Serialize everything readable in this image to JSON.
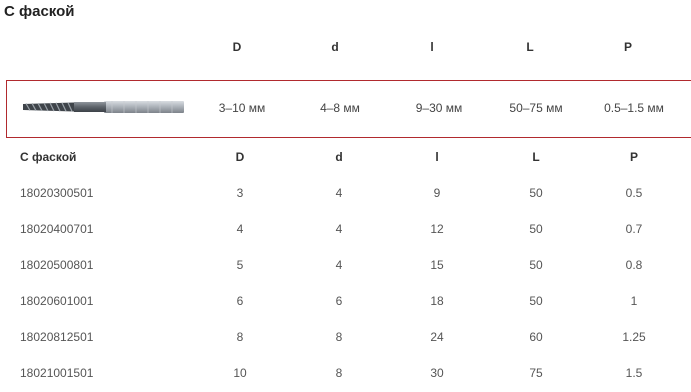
{
  "title": "С фаской",
  "header_columns": [
    "D",
    "d",
    "l",
    "L",
    "P"
  ],
  "feature_row": {
    "image_icon": "end-mill-tool-image",
    "values": [
      "3–10 мм",
      "4–8 мм",
      "9–30 мм",
      "50–75 мм",
      "0.5–1.5 мм"
    ]
  },
  "table": {
    "headers": [
      "С фаской",
      "D",
      "d",
      "l",
      "L",
      "P"
    ],
    "rows": [
      [
        "18020300501",
        "3",
        "4",
        "9",
        "50",
        "0.5"
      ],
      [
        "18020400701",
        "4",
        "4",
        "12",
        "50",
        "0.7"
      ],
      [
        "18020500801",
        "5",
        "4",
        "15",
        "50",
        "0.8"
      ],
      [
        "18020601001",
        "6",
        "6",
        "18",
        "50",
        "1"
      ],
      [
        "18020812501",
        "8",
        "8",
        "24",
        "60",
        "1.25"
      ],
      [
        "18021001501",
        "10",
        "8",
        "30",
        "75",
        "1.5"
      ]
    ]
  },
  "colors": {
    "highlight_border": "#b12a2e",
    "text": "#333333"
  }
}
